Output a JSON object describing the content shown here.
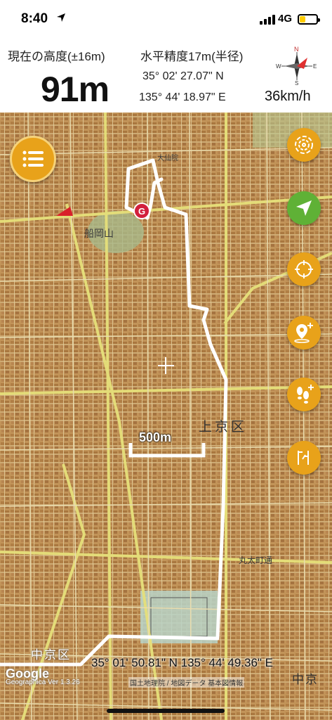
{
  "status_bar": {
    "time": "8:40",
    "network": "4G",
    "battery_level": 0.35
  },
  "header": {
    "altitude_label": "現在の高度(±16m)",
    "altitude_value": "91m",
    "accuracy_label": "水平精度17m(半径)",
    "latitude": "35° 02' 27.07\" N",
    "longitude": "135° 44' 18.97\" E",
    "speed": "36km/h",
    "compass_labels": {
      "north": "N",
      "south": "S",
      "east": "E",
      "west": "W"
    }
  },
  "map": {
    "ward_labels": [
      "上京区",
      "中京区",
      "中京"
    ],
    "place_labels": [
      "船岡山",
      "大仙院",
      "丸太町通"
    ],
    "scale_label": "500m",
    "center_coordinates": "35° 01' 50.81\" N 135° 44' 49.36\" E",
    "google_label": "Google",
    "version_label": "Geographica Ver 1.3.26",
    "attribution": "国土地理院 / 地図データ 基本図情報",
    "goal_marker_label": "G"
  },
  "buttons": {
    "menu": "menu",
    "track": "track-record",
    "locate": "current-location",
    "center": "center-target",
    "add_point": "add-point",
    "add_footprint": "add-footprint",
    "sign": "direction-sign"
  },
  "colors": {
    "accent_orange": "#e8a21a",
    "green_button": "#5fb136",
    "track_white": "#ffffff",
    "map_base": "#c9a06a",
    "road_yellow": "#e8e070"
  }
}
